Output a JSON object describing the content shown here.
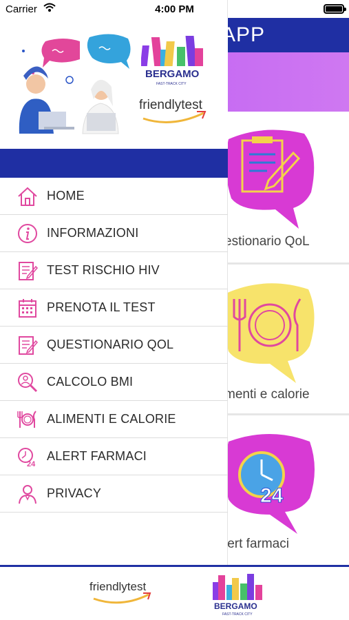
{
  "status_bar": {
    "carrier": "Carrier",
    "time": "4:00 PM"
  },
  "background_app": {
    "title_fragment": "APP",
    "cards": [
      {
        "label": "estionario QoL",
        "icon": "clipboard-pencil-icon"
      },
      {
        "label": "menti e calorie",
        "icon": "plate-cutlery-icon"
      },
      {
        "label": "lert farmaci",
        "icon": "clock-24-icon"
      }
    ]
  },
  "drawer": {
    "header": {
      "logo_bergamo": "BERGAMO",
      "logo_bergamo_sub": "FAST-TRACK CITY",
      "logo_friendly": "friendlytest"
    },
    "menu": [
      {
        "label": "HOME",
        "icon": "home-icon"
      },
      {
        "label": "INFORMAZIONI",
        "icon": "info-icon"
      },
      {
        "label": "TEST RISCHIO HIV",
        "icon": "test-form-icon"
      },
      {
        "label": "PRENOTA IL TEST",
        "icon": "calendar-icon"
      },
      {
        "label": "QUESTIONARIO QOL",
        "icon": "questionnaire-icon"
      },
      {
        "label": "CALCOLO BMI",
        "icon": "bmi-scale-icon"
      },
      {
        "label": "ALIMENTI E CALORIE",
        "icon": "food-plate-icon"
      },
      {
        "label": "ALERT FARMACI",
        "icon": "clock-24-icon"
      },
      {
        "label": "PRIVACY",
        "icon": "person-icon"
      }
    ]
  },
  "footer": {
    "logo_friendly": "friendlytest",
    "logo_bergamo": "BERGAMO",
    "logo_bergamo_sub": "FAST-TRACK CITY"
  },
  "colors": {
    "primary_blue": "#1f2fa3",
    "banner_purple": "#c06af2",
    "icon_pink": "#e0489f",
    "bubble_magenta": "#d83ad4",
    "bubble_yellow": "#f7e36b"
  }
}
